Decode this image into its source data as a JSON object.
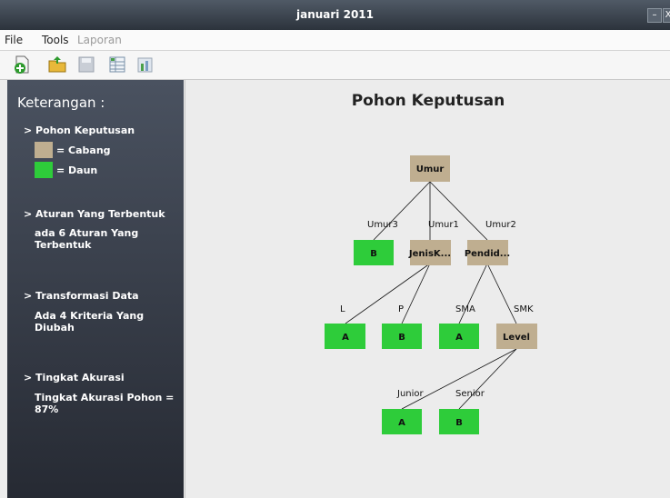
{
  "window": {
    "title": "januari 2011",
    "min_glyph": "–",
    "close_glyph": "X"
  },
  "menu": {
    "file": "File",
    "tools": "Tools",
    "laporan": "Laporan"
  },
  "toolbar": {
    "icons": [
      "new-document-icon",
      "open-folder-icon",
      "save-icon",
      "table-view-icon",
      "chart-icon"
    ]
  },
  "sidebar": {
    "title": "Keterangan :",
    "pohon_heading": "> Pohon Keputusan",
    "cabang_label": "= Cabang",
    "daun_label": "= Daun",
    "aturan_heading": "> Aturan Yang Terbentuk",
    "aturan_value": "ada 6 Aturan Yang Terbentuk",
    "transformasi_heading": "> Transformasi Data",
    "transformasi_value": "Ada 4 Kriteria Yang Diubah",
    "akurasi_heading": "> Tingkat Akurasi",
    "akurasi_value": "Tingkat Akurasi Pohon = 87%"
  },
  "colors": {
    "cabang": "#bfae90",
    "daun": "#2ecc3a"
  },
  "tree": {
    "title": "Pohon Keputusan",
    "nodes": {
      "umur": "Umur",
      "b1": "B",
      "jenisk": "JenisK...",
      "pendid": "Pendid...",
      "a1": "A",
      "b2": "B",
      "a2": "A",
      "level": "Level",
      "a3": "A",
      "b3": "B"
    },
    "edges": {
      "umur3": "Umur3",
      "umur1": "Umur1",
      "umur2": "Umur2",
      "l": "L",
      "p": "P",
      "sma": "SMA",
      "smk": "SMK",
      "junior": "Junior",
      "senior": "Senior"
    }
  }
}
